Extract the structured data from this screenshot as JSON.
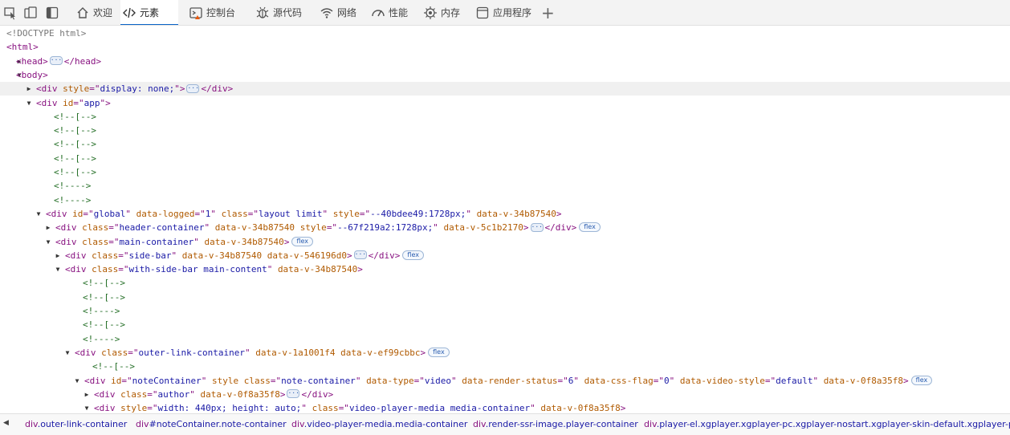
{
  "toolbar": {
    "tabs": [
      {
        "label": "欢迎",
        "icon": "home-icon"
      },
      {
        "label": "元素",
        "icon": "code-icon",
        "active": true
      },
      {
        "label": "控制台",
        "icon": "console-icon"
      },
      {
        "label": "源代码",
        "icon": "bug-icon"
      },
      {
        "label": "网络",
        "icon": "wifi-icon"
      },
      {
        "label": "性能",
        "icon": "gauge-icon"
      },
      {
        "label": "内存",
        "icon": "memory-icon"
      },
      {
        "label": "应用程序",
        "icon": "application-icon"
      }
    ],
    "plus": "+",
    "accent": "#0a64c8"
  },
  "tree": {
    "lines": [
      {
        "depth": 0,
        "tw": "",
        "parts": [
          [
            "d",
            "<!DOCTYPE html>"
          ]
        ]
      },
      {
        "depth": 0,
        "tw": "",
        "parts": [
          [
            "t",
            "<html>"
          ]
        ]
      },
      {
        "depth": 1,
        "tw": "▶",
        "parts": [
          [
            "t",
            "<head>"
          ],
          [
            "more",
            "···"
          ],
          [
            "t",
            "</head>"
          ]
        ]
      },
      {
        "depth": 1,
        "tw": "▼",
        "parts": [
          [
            "t",
            "<body>"
          ]
        ]
      },
      {
        "depth": 2,
        "tw": "▶",
        "hl": true,
        "parts": [
          [
            "t",
            "<div "
          ],
          [
            "a",
            "style"
          ],
          [
            "t",
            "=\""
          ],
          [
            "v",
            "display: none;"
          ],
          [
            "t",
            "\">"
          ],
          [
            "more",
            "···"
          ],
          [
            "t",
            "</div>"
          ]
        ]
      },
      {
        "depth": 2,
        "tw": "▼",
        "parts": [
          [
            "t",
            "<div "
          ],
          [
            "a",
            "id"
          ],
          [
            "t",
            "=\""
          ],
          [
            "v",
            "app"
          ],
          [
            "t",
            "\">"
          ]
        ]
      },
      {
        "depth": 3,
        "tw": "",
        "parts": [
          [
            "c",
            "<!--[-->"
          ]
        ]
      },
      {
        "depth": 3,
        "tw": "",
        "parts": [
          [
            "c",
            "<!--[-->"
          ]
        ]
      },
      {
        "depth": 3,
        "tw": "",
        "parts": [
          [
            "c",
            "<!--[-->"
          ]
        ]
      },
      {
        "depth": 3,
        "tw": "",
        "parts": [
          [
            "c",
            "<!--[-->"
          ]
        ]
      },
      {
        "depth": 3,
        "tw": "",
        "parts": [
          [
            "c",
            "<!--[-->"
          ]
        ]
      },
      {
        "depth": 3,
        "tw": "",
        "parts": [
          [
            "c",
            "<!---->"
          ]
        ]
      },
      {
        "depth": 3,
        "tw": "",
        "parts": [
          [
            "c",
            "<!---->"
          ]
        ]
      },
      {
        "depth": 3,
        "tw": "▼",
        "parts": [
          [
            "t",
            "<div "
          ],
          [
            "a",
            "id"
          ],
          [
            "t",
            "=\""
          ],
          [
            "v",
            "global"
          ],
          [
            "t",
            "\" "
          ],
          [
            "a",
            "data-logged"
          ],
          [
            "t",
            "=\""
          ],
          [
            "v",
            "1"
          ],
          [
            "t",
            "\" "
          ],
          [
            "a",
            "class"
          ],
          [
            "t",
            "=\""
          ],
          [
            "v",
            "layout limit"
          ],
          [
            "t",
            "\" "
          ],
          [
            "a",
            "style"
          ],
          [
            "t",
            "=\""
          ],
          [
            "v",
            "--40bdee49:1728px;"
          ],
          [
            "t",
            "\" "
          ],
          [
            "a",
            "data-v-34b87540"
          ],
          [
            "t",
            ">"
          ]
        ]
      },
      {
        "depth": 4,
        "tw": "▶",
        "parts": [
          [
            "t",
            "<div "
          ],
          [
            "a",
            "class"
          ],
          [
            "t",
            "=\""
          ],
          [
            "v",
            "header-container"
          ],
          [
            "t",
            "\" "
          ],
          [
            "a",
            "data-v-34b87540"
          ],
          [
            "t",
            " "
          ],
          [
            "a",
            "style"
          ],
          [
            "t",
            "=\""
          ],
          [
            "v",
            "--67f219a2:1728px;"
          ],
          [
            "t",
            "\" "
          ],
          [
            "a",
            "data-v-5c1b2170"
          ],
          [
            "t",
            ">"
          ],
          [
            "more",
            "···"
          ],
          [
            "t",
            "</div>"
          ],
          [
            "badge",
            "flex"
          ]
        ]
      },
      {
        "depth": 4,
        "tw": "▼",
        "parts": [
          [
            "t",
            "<div "
          ],
          [
            "a",
            "class"
          ],
          [
            "t",
            "=\""
          ],
          [
            "v",
            "main-container"
          ],
          [
            "t",
            "\" "
          ],
          [
            "a",
            "data-v-34b87540"
          ],
          [
            "t",
            ">"
          ],
          [
            "badge",
            "flex"
          ]
        ]
      },
      {
        "depth": 5,
        "tw": "▶",
        "parts": [
          [
            "t",
            "<div "
          ],
          [
            "a",
            "class"
          ],
          [
            "t",
            "=\""
          ],
          [
            "v",
            "side-bar"
          ],
          [
            "t",
            "\" "
          ],
          [
            "a",
            "data-v-34b87540"
          ],
          [
            "t",
            " "
          ],
          [
            "a",
            "data-v-546196d0"
          ],
          [
            "t",
            ">"
          ],
          [
            "more",
            "···"
          ],
          [
            "t",
            "</div>"
          ],
          [
            "badge",
            "flex"
          ]
        ]
      },
      {
        "depth": 5,
        "tw": "▼",
        "parts": [
          [
            "t",
            "<div "
          ],
          [
            "a",
            "class"
          ],
          [
            "t",
            "=\""
          ],
          [
            "v",
            "with-side-bar main-content"
          ],
          [
            "t",
            "\" "
          ],
          [
            "a",
            "data-v-34b87540"
          ],
          [
            "t",
            ">"
          ]
        ]
      },
      {
        "depth": 6,
        "tw": "",
        "parts": [
          [
            "c",
            "<!--[-->"
          ]
        ]
      },
      {
        "depth": 6,
        "tw": "",
        "parts": [
          [
            "c",
            "<!--[-->"
          ]
        ]
      },
      {
        "depth": 6,
        "tw": "",
        "parts": [
          [
            "c",
            "<!---->"
          ]
        ]
      },
      {
        "depth": 6,
        "tw": "",
        "parts": [
          [
            "c",
            "<!--[-->"
          ]
        ]
      },
      {
        "depth": 6,
        "tw": "",
        "parts": [
          [
            "c",
            "<!---->"
          ]
        ]
      },
      {
        "depth": 6,
        "tw": "▼",
        "parts": [
          [
            "t",
            "<div "
          ],
          [
            "a",
            "class"
          ],
          [
            "t",
            "=\""
          ],
          [
            "v",
            "outer-link-container"
          ],
          [
            "t",
            "\" "
          ],
          [
            "a",
            "data-v-1a1001f4"
          ],
          [
            "t",
            " "
          ],
          [
            "a",
            "data-v-ef99cbbc"
          ],
          [
            "t",
            ">"
          ],
          [
            "badge",
            "flex"
          ]
        ]
      },
      {
        "depth": 7,
        "tw": "",
        "parts": [
          [
            "c",
            "<!--[-->"
          ]
        ]
      },
      {
        "depth": 7,
        "tw": "▼",
        "parts": [
          [
            "t",
            "<div "
          ],
          [
            "a",
            "id"
          ],
          [
            "t",
            "=\""
          ],
          [
            "v",
            "noteContainer"
          ],
          [
            "t",
            "\" "
          ],
          [
            "a",
            "style"
          ],
          [
            "t",
            " "
          ],
          [
            "a",
            "class"
          ],
          [
            "t",
            "=\""
          ],
          [
            "v",
            "note-container"
          ],
          [
            "t",
            "\" "
          ],
          [
            "a",
            "data-type"
          ],
          [
            "t",
            "=\""
          ],
          [
            "v",
            "video"
          ],
          [
            "t",
            "\" "
          ],
          [
            "a",
            "data-render-status"
          ],
          [
            "t",
            "=\""
          ],
          [
            "v",
            "6"
          ],
          [
            "t",
            "\" "
          ],
          [
            "a",
            "data-css-flag"
          ],
          [
            "t",
            "=\""
          ],
          [
            "v",
            "0"
          ],
          [
            "t",
            "\" "
          ],
          [
            "a",
            "data-video-style"
          ],
          [
            "t",
            "=\""
          ],
          [
            "v",
            "default"
          ],
          [
            "t",
            "\" "
          ],
          [
            "a",
            "data-v-0f8a35f8"
          ],
          [
            "t",
            ">"
          ],
          [
            "badge",
            "flex"
          ]
        ]
      },
      {
        "depth": 8,
        "tw": "▶",
        "parts": [
          [
            "t",
            "<div "
          ],
          [
            "a",
            "class"
          ],
          [
            "t",
            "=\""
          ],
          [
            "v",
            "author"
          ],
          [
            "t",
            "\" "
          ],
          [
            "a",
            "data-v-0f8a35f8"
          ],
          [
            "t",
            ">"
          ],
          [
            "more",
            "···"
          ],
          [
            "t",
            "</div>"
          ]
        ]
      },
      {
        "depth": 8,
        "tw": "▼",
        "parts": [
          [
            "t",
            "<div "
          ],
          [
            "a",
            "style"
          ],
          [
            "t",
            "=\""
          ],
          [
            "v",
            "width: 440px; height: auto;"
          ],
          [
            "t",
            "\" "
          ],
          [
            "a",
            "class"
          ],
          [
            "t",
            "=\""
          ],
          [
            "v",
            "video-player-media media-container"
          ],
          [
            "t",
            "\" "
          ],
          [
            "a",
            "data-v-0f8a35f8"
          ],
          [
            "t",
            ">"
          ]
        ]
      }
    ]
  },
  "breadcrumbs": {
    "nav": "◀",
    "items": [
      {
        "tag": "div",
        "rest": ".outer-link-container"
      },
      {
        "tag": "div",
        "rest": "#noteContainer.note-container"
      },
      {
        "tag": "div",
        "rest": ".video-player-media.media-container"
      },
      {
        "tag": "div",
        "rest": ".render-ssr-image.player-container"
      },
      {
        "tag": "div",
        "rest": ".player-el.xgplayer.xgplayer-pc.xgplayer-nostart.xgplayer-skin-default.xgplayer-pause"
      }
    ]
  }
}
